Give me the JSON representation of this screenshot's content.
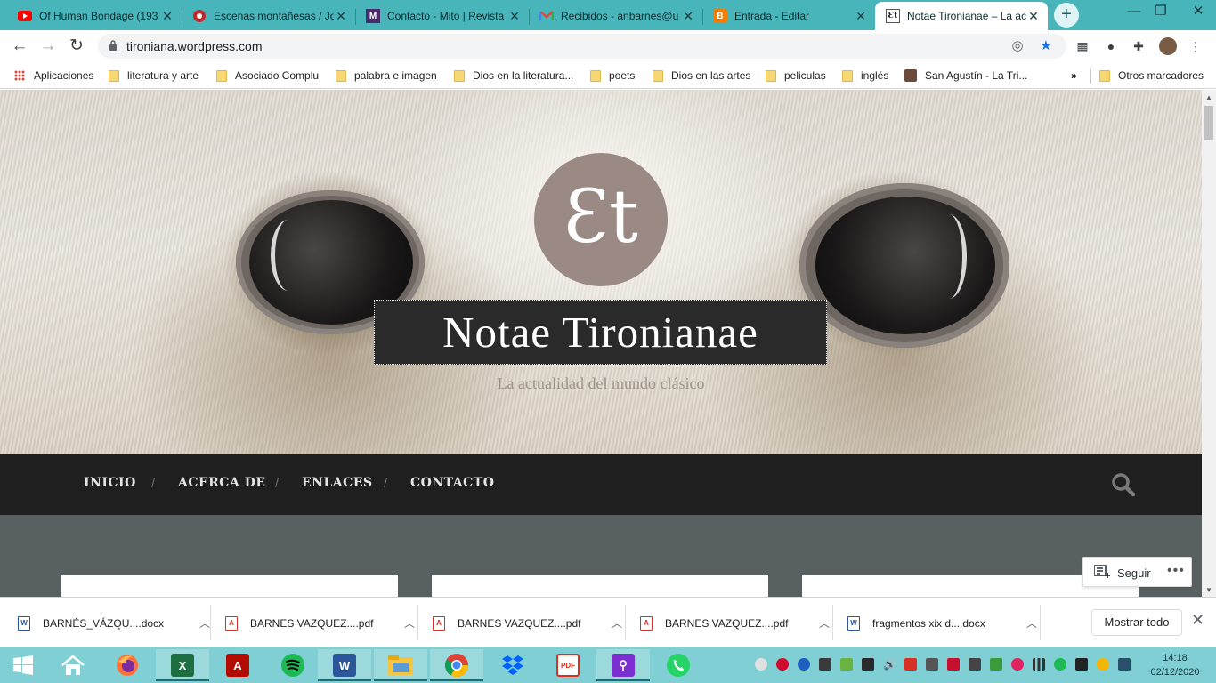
{
  "browser": {
    "tabs": [
      {
        "title": "Of Human Bondage (193",
        "favicon": "youtube-favicon",
        "color": "#ff0000"
      },
      {
        "title": "Escenas montañesas / Jo",
        "favicon": "cervantes-favicon",
        "color": "#c1272d"
      },
      {
        "title": "Contacto - Mito | Revista",
        "favicon": "mito-favicon",
        "color": "#4a2c6d"
      },
      {
        "title": "Recibidos - anbarnes@u",
        "favicon": "gmail-favicon",
        "color": "#ea4335"
      },
      {
        "title": "Entrada - Editar",
        "favicon": "blogger-favicon",
        "color": "#f57d00"
      },
      {
        "title": "Notae Tironianae – La ac",
        "favicon": "site-favicon",
        "color": "#9b8a83"
      }
    ],
    "url": "tironiana.wordpress.com",
    "bookmarks": [
      {
        "label": "Aplicaciones",
        "type": "apps"
      },
      {
        "label": "literatura y arte",
        "type": "folder"
      },
      {
        "label": "Asociado Complu",
        "type": "folder"
      },
      {
        "label": "palabra e imagen",
        "type": "folder"
      },
      {
        "label": "Dios en la literatura...",
        "type": "folder"
      },
      {
        "label": "poets",
        "type": "folder"
      },
      {
        "label": "Dios en las artes",
        "type": "folder"
      },
      {
        "label": "peliculas",
        "type": "folder"
      },
      {
        "label": "inglés",
        "type": "folder"
      },
      {
        "label": "San Agustín - La Tri...",
        "type": "page"
      }
    ],
    "bookmarks_overflow": "»",
    "other_bookmarks": "Otros marcadores"
  },
  "site": {
    "logo_glyph": "Ɛt",
    "title": "Notae Tironianae",
    "tagline": "La actualidad del mundo clásico",
    "menu": [
      "INICIO",
      "ACERCA DE",
      "ENLACES",
      "CONTACTO"
    ],
    "menu_separator": "/",
    "follow_label": "Seguir",
    "follow_more": "•••",
    "colors": {
      "logo_bg": "#9b8a83",
      "menu_bg": "#1f1f1f",
      "content_bg": "#586062"
    }
  },
  "downloads": {
    "items": [
      {
        "name": "BARNÉS_VÁZQU....docx",
        "type": "docx"
      },
      {
        "name": "BARNES VAZQUEZ....pdf",
        "type": "pdf"
      },
      {
        "name": "BARNES VAZQUEZ....pdf",
        "type": "pdf"
      },
      {
        "name": "BARNES VAZQUEZ....pdf",
        "type": "pdf"
      },
      {
        "name": "fragmentos xix d....docx",
        "type": "docx"
      }
    ],
    "show_all": "Mostrar todo"
  },
  "taskbar": {
    "apps": [
      "start-button",
      "file-explorer",
      "firefox",
      "excel",
      "acrobat",
      "spotify",
      "word",
      "file-manager",
      "chrome",
      "dropbox",
      "pdf-reader",
      "search-app",
      "whatsapp"
    ],
    "time": "14:18",
    "date": "02/12/2020"
  }
}
